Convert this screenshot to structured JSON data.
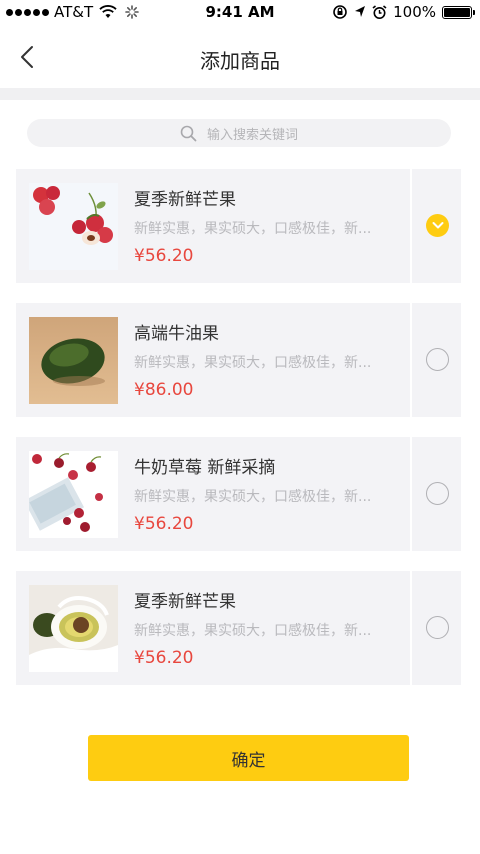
{
  "status_bar": {
    "carrier": "AT&T",
    "time": "9:41 AM",
    "battery": "100%"
  },
  "nav": {
    "title": "添加商品"
  },
  "search": {
    "placeholder": "输入搜索关键词"
  },
  "products": [
    {
      "name": "夏季新鲜芒果",
      "desc": "新鲜实惠，果实硕大，口感极佳，新...",
      "price": "¥56.20",
      "selected": true,
      "image": "lychee"
    },
    {
      "name": "高端牛油果",
      "desc": "新鲜实惠，果实硕大，口感极佳，新...",
      "price": "¥86.00",
      "selected": false,
      "image": "avocado"
    },
    {
      "name": "牛奶草莓 新鲜采摘",
      "desc": "新鲜实惠，果实硕大，口感极佳，新...",
      "price": "¥56.20",
      "selected": false,
      "image": "cherries"
    },
    {
      "name": "夏季新鲜芒果",
      "desc": "新鲜实惠，果实硕大，口感极佳，新...",
      "price": "¥56.20",
      "selected": false,
      "image": "avocado-half"
    }
  ],
  "confirm_label": "确定",
  "colors": {
    "accent": "#fecc11",
    "price": "#e8473e",
    "card_bg": "#f3f3f6"
  }
}
